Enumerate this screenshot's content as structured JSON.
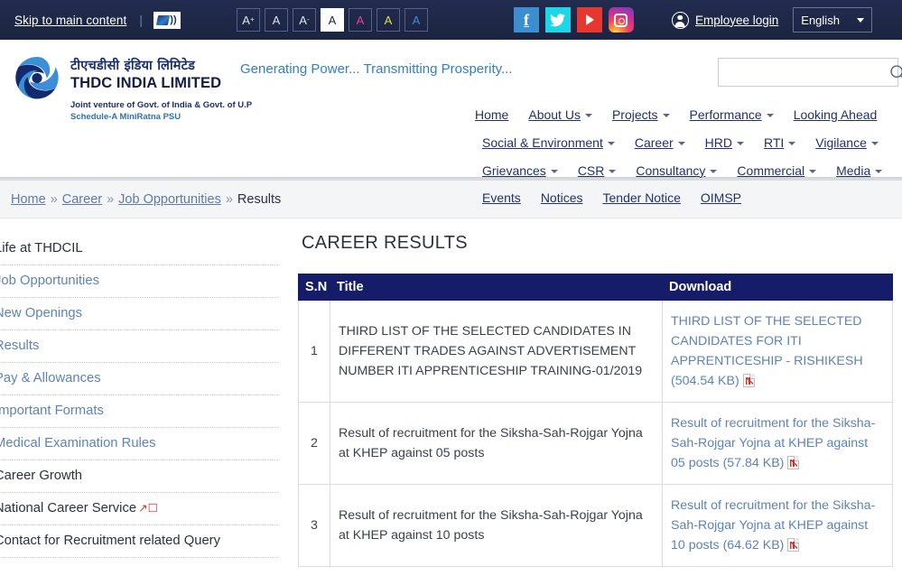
{
  "topbar": {
    "skip_label": "Skip to main content",
    "separator": "|",
    "screen_reader_icon": "screen-reader-icon",
    "font_buttons": [
      {
        "label": "A",
        "sup": "+",
        "state": "normal"
      },
      {
        "label": "A",
        "sup": "",
        "state": "normal"
      },
      {
        "label": "A",
        "sup": "-",
        "state": "normal"
      },
      {
        "label": "A",
        "sup": "",
        "state": "selected"
      },
      {
        "label": "A",
        "sup": "",
        "state": "magenta"
      },
      {
        "label": "A",
        "sup": "",
        "state": "yellow"
      },
      {
        "label": "A",
        "sup": "",
        "state": "blue"
      }
    ],
    "social": [
      {
        "name": "facebook",
        "glyph": "f",
        "color": "#3b8ed0"
      },
      {
        "name": "twitter",
        "glyph": "",
        "color": "#1dd6e8"
      },
      {
        "name": "youtube",
        "glyph": "",
        "color": "#e8372e"
      },
      {
        "name": "instagram",
        "glyph": "",
        "color": "#d22f93"
      }
    ],
    "employee_login": "Employee login",
    "language": "English"
  },
  "header": {
    "brand_hindi": "टीएचडीसी इंडिया लिमिटेड",
    "brand_english": "THDC INDIA LIMITED",
    "brand_sub1": "Joint venture of Govt. of India & Govt. of U.P",
    "brand_sub2": "Schedule-A MiniRatna PSU",
    "tagline": "Generating Power... Transmitting Prosperity...",
    "search_placeholder": "",
    "search_value": ""
  },
  "nav": {
    "items": [
      {
        "label": "Home",
        "caret": false
      },
      {
        "label": "About Us",
        "caret": true
      },
      {
        "label": "Projects",
        "caret": true
      },
      {
        "label": "Performance",
        "caret": true
      },
      {
        "label": "Looking Ahead",
        "caret": false
      },
      {
        "label": "Social & Environment",
        "caret": true
      },
      {
        "label": "Career",
        "caret": true
      },
      {
        "label": "HRD",
        "caret": true
      },
      {
        "label": "RTI",
        "caret": true
      },
      {
        "label": "Vigilance",
        "caret": true
      },
      {
        "label": "Grievances",
        "caret": true
      },
      {
        "label": "CSR",
        "caret": true
      },
      {
        "label": "Consultancy",
        "caret": true
      },
      {
        "label": "Commercial",
        "caret": true
      },
      {
        "label": "Media",
        "caret": true
      },
      {
        "label": "Events",
        "caret": false
      },
      {
        "label": "Notices",
        "caret": false
      },
      {
        "label": "Tender Notice",
        "caret": false
      },
      {
        "label": "OIMSP",
        "caret": false
      }
    ]
  },
  "breadcrumb": {
    "items": [
      "Home",
      "Career",
      "Job Opportunities",
      "Results"
    ],
    "separator": "»",
    "current_index": 3
  },
  "sidebar": {
    "items": [
      {
        "label": "Life at THDCIL",
        "style": "dark",
        "external": false
      },
      {
        "label": "Job Opportunities",
        "style": "link",
        "external": false
      },
      {
        "label": "New Openings",
        "style": "link",
        "external": false
      },
      {
        "label": "Results",
        "style": "link",
        "external": false
      },
      {
        "label": "Pay & Allowances",
        "style": "link",
        "external": false
      },
      {
        "label": "Important Formats",
        "style": "link",
        "external": false
      },
      {
        "label": "Medical Examination Rules",
        "style": "link",
        "external": false
      },
      {
        "label": "Career Growth",
        "style": "dark",
        "external": false
      },
      {
        "label": "National Career Service",
        "style": "dark",
        "external": true
      },
      {
        "label": "Contact for Recruitment related Query",
        "style": "dark",
        "external": false
      }
    ],
    "external_icon": "external-link-icon"
  },
  "main": {
    "title": "CAREER RESULTS",
    "table": {
      "headers": [
        "S.N",
        "Title",
        "Download"
      ],
      "rows": [
        {
          "sn": "1",
          "title": "THIRD LIST OF THE SELECTED CANDIDATES IN DIFFERENT TRADES AGAINST ADVERTISEMENT NUMBER ITI APPRENTICESHIP TRAINING-01/2019",
          "download": "THIRD LIST OF THE SELECTED CANDIDATES FOR ITI APPRENTICESHIP - RISHIKESH (504.54 KB)",
          "file_size": "504.54 KB",
          "file_type": "pdf"
        },
        {
          "sn": "2",
          "title": "Result of recruitment for the Siksha-Sah-Rojgar Yojna at KHEP against 05 posts",
          "download": "Result of recruitment for the Siksha-Sah-Rojgar Yojna at KHEP against 05 posts (57.84 KB)",
          "file_size": "57.84 KB",
          "file_type": "pdf"
        },
        {
          "sn": "3",
          "title": "Result of recruitment for the Siksha-Sah-Rojgar Yojna at KHEP against 10 posts",
          "download": "Result of recruitment for the Siksha-Sah-Rojgar Yojna at KHEP against 10 posts (64.62 KB)",
          "file_size": "64.62 KB",
          "file_type": "pdf"
        }
      ]
    }
  },
  "colors": {
    "topbar_bg": "#1e2746",
    "table_header_bg": "#151d6b",
    "link_blue": "#5d83b5",
    "tagline_blue": "#2f7fc9",
    "brand_navy": "#141b44",
    "pdf_red": "#d0342c"
  }
}
